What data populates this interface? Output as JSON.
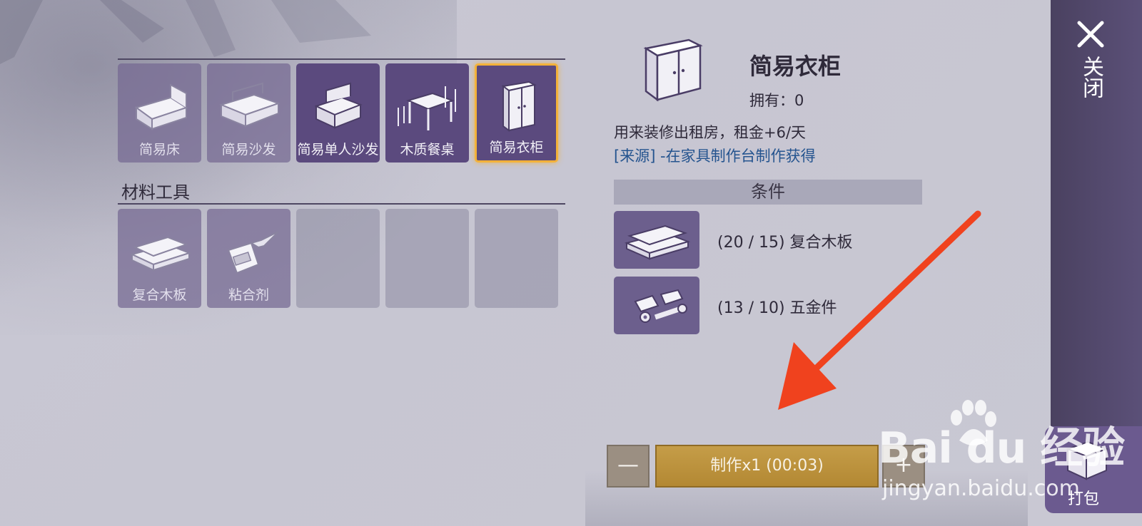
{
  "furniture_slots": [
    {
      "label": "简易床",
      "state": "dim",
      "icon": "bed-icon"
    },
    {
      "label": "简易沙发",
      "state": "dim",
      "icon": "sofa-icon"
    },
    {
      "label": "简易单人沙发",
      "state": "lit",
      "icon": "armchair-icon"
    },
    {
      "label": "木质餐桌",
      "state": "lit",
      "icon": "dining-table-icon"
    },
    {
      "label": "简易衣柜",
      "state": "selected",
      "icon": "wardrobe-icon"
    }
  ],
  "materials_section": {
    "title": "材料工具",
    "slots": [
      {
        "label": "复合木板",
        "icon": "wood-planks-icon"
      },
      {
        "label": "粘合剂",
        "icon": "glue-icon"
      },
      {
        "label": ""
      },
      {
        "label": ""
      },
      {
        "label": ""
      }
    ]
  },
  "detail": {
    "name": "简易衣柜",
    "owned": "拥有：0",
    "description": "用来装修出租房，租金+6/天",
    "source": "[来源] -在家具制作台制作获得",
    "conditions_title": "条件",
    "requirements": [
      {
        "text": "(20 / 15) 复合木板",
        "icon": "wood-planks-icon"
      },
      {
        "text": "(13 / 10) 五金件",
        "icon": "hardware-icon"
      }
    ]
  },
  "actions": {
    "minus": "—",
    "make": "制作x1 (00:03)",
    "plus": "+"
  },
  "side": {
    "close": "关闭",
    "pack": "打包"
  },
  "watermark": {
    "logo": "Bai du 经验",
    "url": "jingyan.baidu.com"
  },
  "colors": {
    "selected_border": "#f3b23a",
    "make_button": "#c59d48",
    "source_link": "#25548f",
    "arrow": "#f0421e"
  }
}
